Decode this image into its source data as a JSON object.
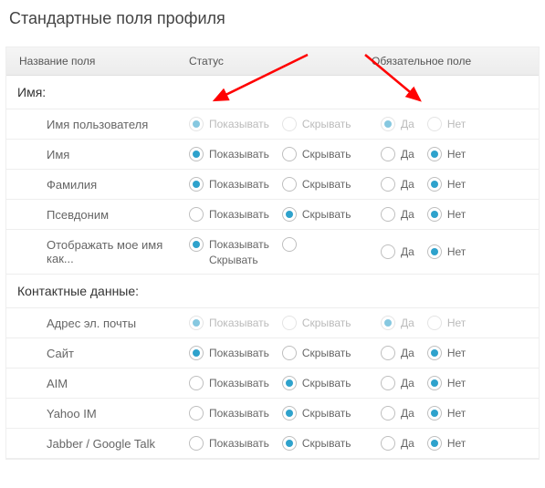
{
  "title": "Стандартные поля профиля",
  "columns": {
    "name": "Название поля",
    "status": "Статус",
    "required": "Обязательное поле"
  },
  "status_labels": {
    "show": "Показывать",
    "hide": "Скрывать"
  },
  "req_labels": {
    "yes": "Да",
    "no": "Нет"
  },
  "sections": [
    {
      "title": "Имя:",
      "rows": [
        {
          "name": "Имя пользователя",
          "status": "show",
          "status_locked": true,
          "required": "yes",
          "required_locked": true
        },
        {
          "name": "Имя",
          "status": "show",
          "status_locked": false,
          "required": "no",
          "required_locked": false
        },
        {
          "name": "Фамилия",
          "status": "show",
          "status_locked": false,
          "required": "no",
          "required_locked": false
        },
        {
          "name": "Псевдоним",
          "status": "hide",
          "status_locked": false,
          "required": "no",
          "required_locked": false
        },
        {
          "name": "Отображать мое имя как...",
          "status": "show",
          "status_locked": false,
          "required": "no",
          "required_locked": false,
          "stacked": true
        }
      ]
    },
    {
      "title": "Контактные данные:",
      "rows": [
        {
          "name": "Адрес эл. почты",
          "status": "show",
          "status_locked": true,
          "required": "yes",
          "required_locked": true
        },
        {
          "name": "Сайт",
          "status": "show",
          "status_locked": false,
          "required": "no",
          "required_locked": false
        },
        {
          "name": "AIM",
          "status": "hide",
          "status_locked": false,
          "required": "no",
          "required_locked": false
        },
        {
          "name": "Yahoo IM",
          "status": "hide",
          "status_locked": false,
          "required": "no",
          "required_locked": false
        },
        {
          "name": "Jabber / Google Talk",
          "status": "hide",
          "status_locked": false,
          "required": "no",
          "required_locked": false
        }
      ]
    }
  ]
}
